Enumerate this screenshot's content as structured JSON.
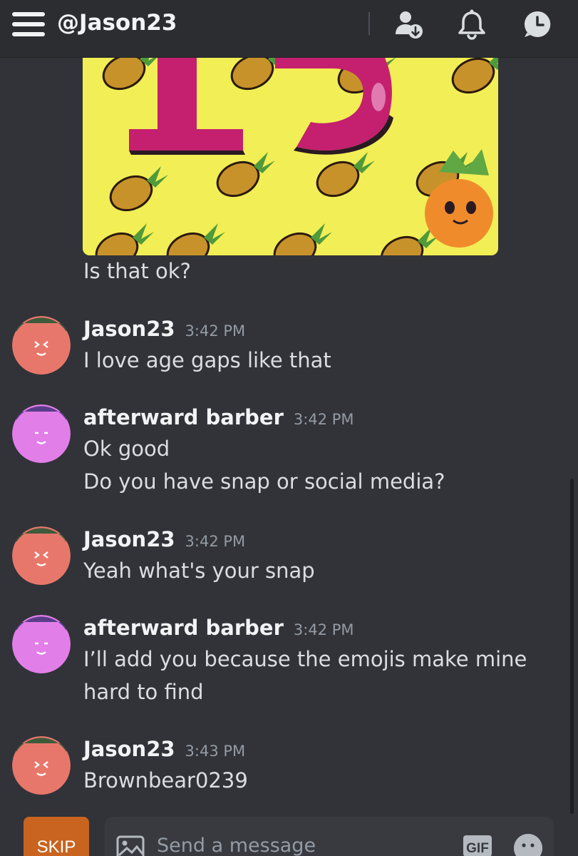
{
  "header": {
    "title": "@Jason23",
    "icons": [
      "menu-icon",
      "add-friend-icon",
      "bell-icon",
      "clock-icon"
    ]
  },
  "chat": {
    "previous_message_tail": "Is that ok?",
    "messages": [
      {
        "author": "Jason23",
        "time": "3:42 PM",
        "lines": [
          "I love age gaps like that"
        ],
        "avatar_color": "#e8776b"
      },
      {
        "author": "afterward barber",
        "time": "3:42 PM",
        "lines": [
          "Ok good",
          "Do you have snap or social media?"
        ],
        "avatar_color": "#e27ee8"
      },
      {
        "author": "Jason23",
        "time": "3:42 PM",
        "lines": [
          "Yeah what's your snap"
        ],
        "avatar_color": "#e8776b"
      },
      {
        "author": "afterward barber",
        "time": "3:42 PM",
        "lines": [
          "I’ll add you because the emojis make mine",
          "hard to find"
        ],
        "avatar_color": "#e27ee8"
      },
      {
        "author": "Jason23",
        "time": "3:43 PM",
        "lines": [
          "Brownbear0239"
        ],
        "avatar_color": "#e8776b"
      }
    ]
  },
  "composer": {
    "skip_label": "SKIP",
    "placeholder": "Send a message",
    "gif_label": "GIF"
  },
  "colors": {
    "background": "#313338",
    "header": "#2b2d31",
    "skip": "#c8641f",
    "gif_background": "#f2ee55",
    "gif_digits": "#c4206f"
  }
}
